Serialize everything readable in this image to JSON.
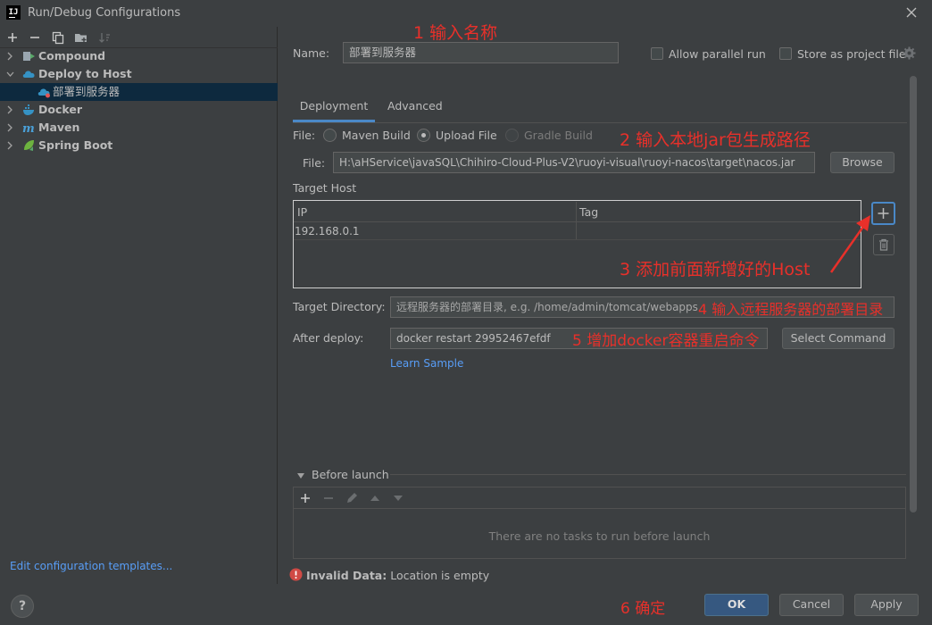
{
  "window": {
    "title": "Run/Debug Configurations",
    "logo_text": "IJ"
  },
  "tree": {
    "items": [
      {
        "label": "Compound"
      },
      {
        "label": "Deploy to Host"
      },
      {
        "label": "部署到服务器"
      },
      {
        "label": "Docker"
      },
      {
        "label": "Maven"
      },
      {
        "label": "Spring Boot"
      }
    ],
    "edit_templates_link": "Edit configuration templates..."
  },
  "config": {
    "name_label": "Name:",
    "name_value": "部署到服务器",
    "allow_parallel_label": "Allow parallel run",
    "store_as_project_label": "Store as project file"
  },
  "tabs": [
    {
      "label": "Deployment"
    },
    {
      "label": "Advanced"
    }
  ],
  "deployment": {
    "file_type_label": "File:",
    "file_types": [
      {
        "label": "Maven Build",
        "selected": false
      },
      {
        "label": "Upload File",
        "selected": true
      },
      {
        "label": "Gradle Build",
        "selected": false
      }
    ],
    "file_path_label": "File:",
    "file_path_value": "H:\\aHService\\javaSQL\\Chihiro-Cloud-Plus-V2\\ruoyi-visual\\ruoyi-nacos\\target\\nacos.jar",
    "browse_label": "Browse",
    "target_host_label": "Target Host",
    "host_table": {
      "columns": [
        "IP",
        "Tag"
      ],
      "rows": [
        {
          "ip": "192.168.0.1",
          "tag": ""
        }
      ]
    },
    "target_directory_label": "Target Directory:",
    "target_directory_placeholder": "远程服务器的部署目录, e.g. /home/admin/tomcat/webapps",
    "after_deploy_label": "After deploy:",
    "after_deploy_value": "docker restart 29952467efdf",
    "select_command_label": "Select Command",
    "learn_sample_link": "Learn Sample"
  },
  "before_launch": {
    "title": "Before launch",
    "empty_text": "There are no tasks to run before launch"
  },
  "validation": {
    "title": "Invalid Data:",
    "message": "Location is empty"
  },
  "buttons": {
    "ok": "OK",
    "cancel": "Cancel",
    "apply": "Apply",
    "help": "?"
  },
  "annotations": {
    "a1": "1 输入名称",
    "a2": "2 输入本地jar包生成路径",
    "a3": "3 添加前面新增好的Host",
    "a4": "4 输入远程服务器的部署目录",
    "a5": "5 增加docker容器重启命令",
    "a6": "6 确定"
  },
  "colors": {
    "accent": "#4a88c7",
    "annotation": "#e8302a",
    "error": "#d04a45",
    "link": "#589df6"
  }
}
